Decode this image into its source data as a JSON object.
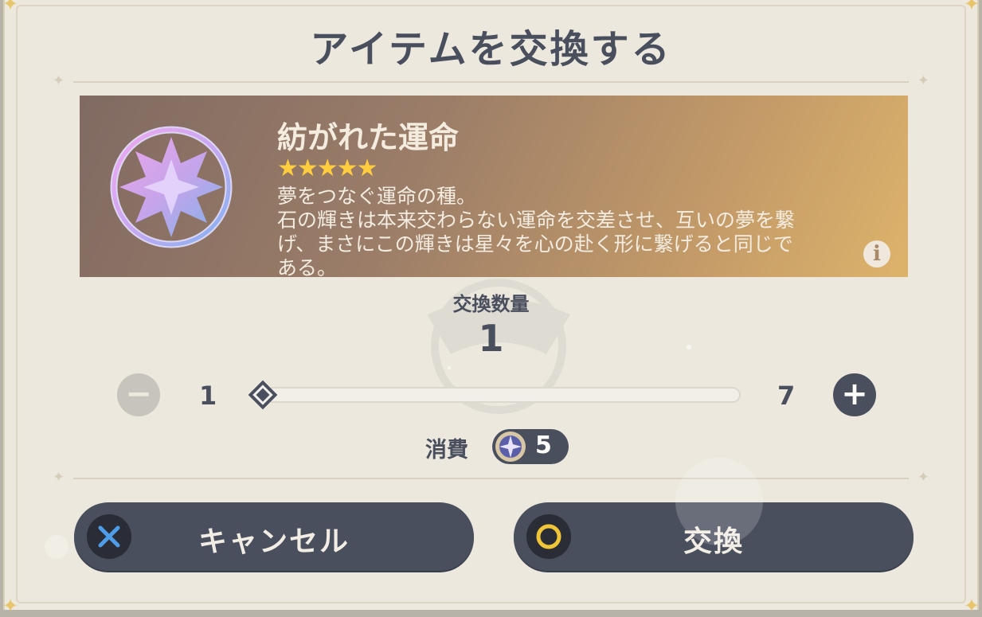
{
  "dialog": {
    "title": "アイテムを交換する"
  },
  "item": {
    "name": "紡がれた運命",
    "rarity": 5,
    "stars_text": "★★★★★",
    "description_line1": "夢をつなぐ運命の種。",
    "description_line2": "石の輝きは本来交わらない運命を交差させ、互いの夢を繋",
    "description_line3": "げ、まさにこの輝きは星々を心の赴く形に繋げると同じで",
    "description_line4": "ある。",
    "icon": "intertwined-fate-icon",
    "info_icon": "info-icon",
    "info_glyph": "i"
  },
  "quantity": {
    "label": "交換数量",
    "value": "1",
    "min": "1",
    "max": "7",
    "slider_fraction": 0,
    "minus_glyph": "−",
    "plus_glyph": "+"
  },
  "cost": {
    "label": "消費",
    "value": "5",
    "icon": "starglitter-icon"
  },
  "buttons": {
    "cancel_label": "キャンセル",
    "confirm_label": "交換",
    "cancel_icon": "cross-icon",
    "confirm_icon": "circle-icon"
  },
  "colors": {
    "primary_dark": "#4a4f5e",
    "background": "#ece8de",
    "star": "#ffcd3d",
    "cancel_icon": "#4f9de8",
    "confirm_icon": "#f0c538"
  }
}
